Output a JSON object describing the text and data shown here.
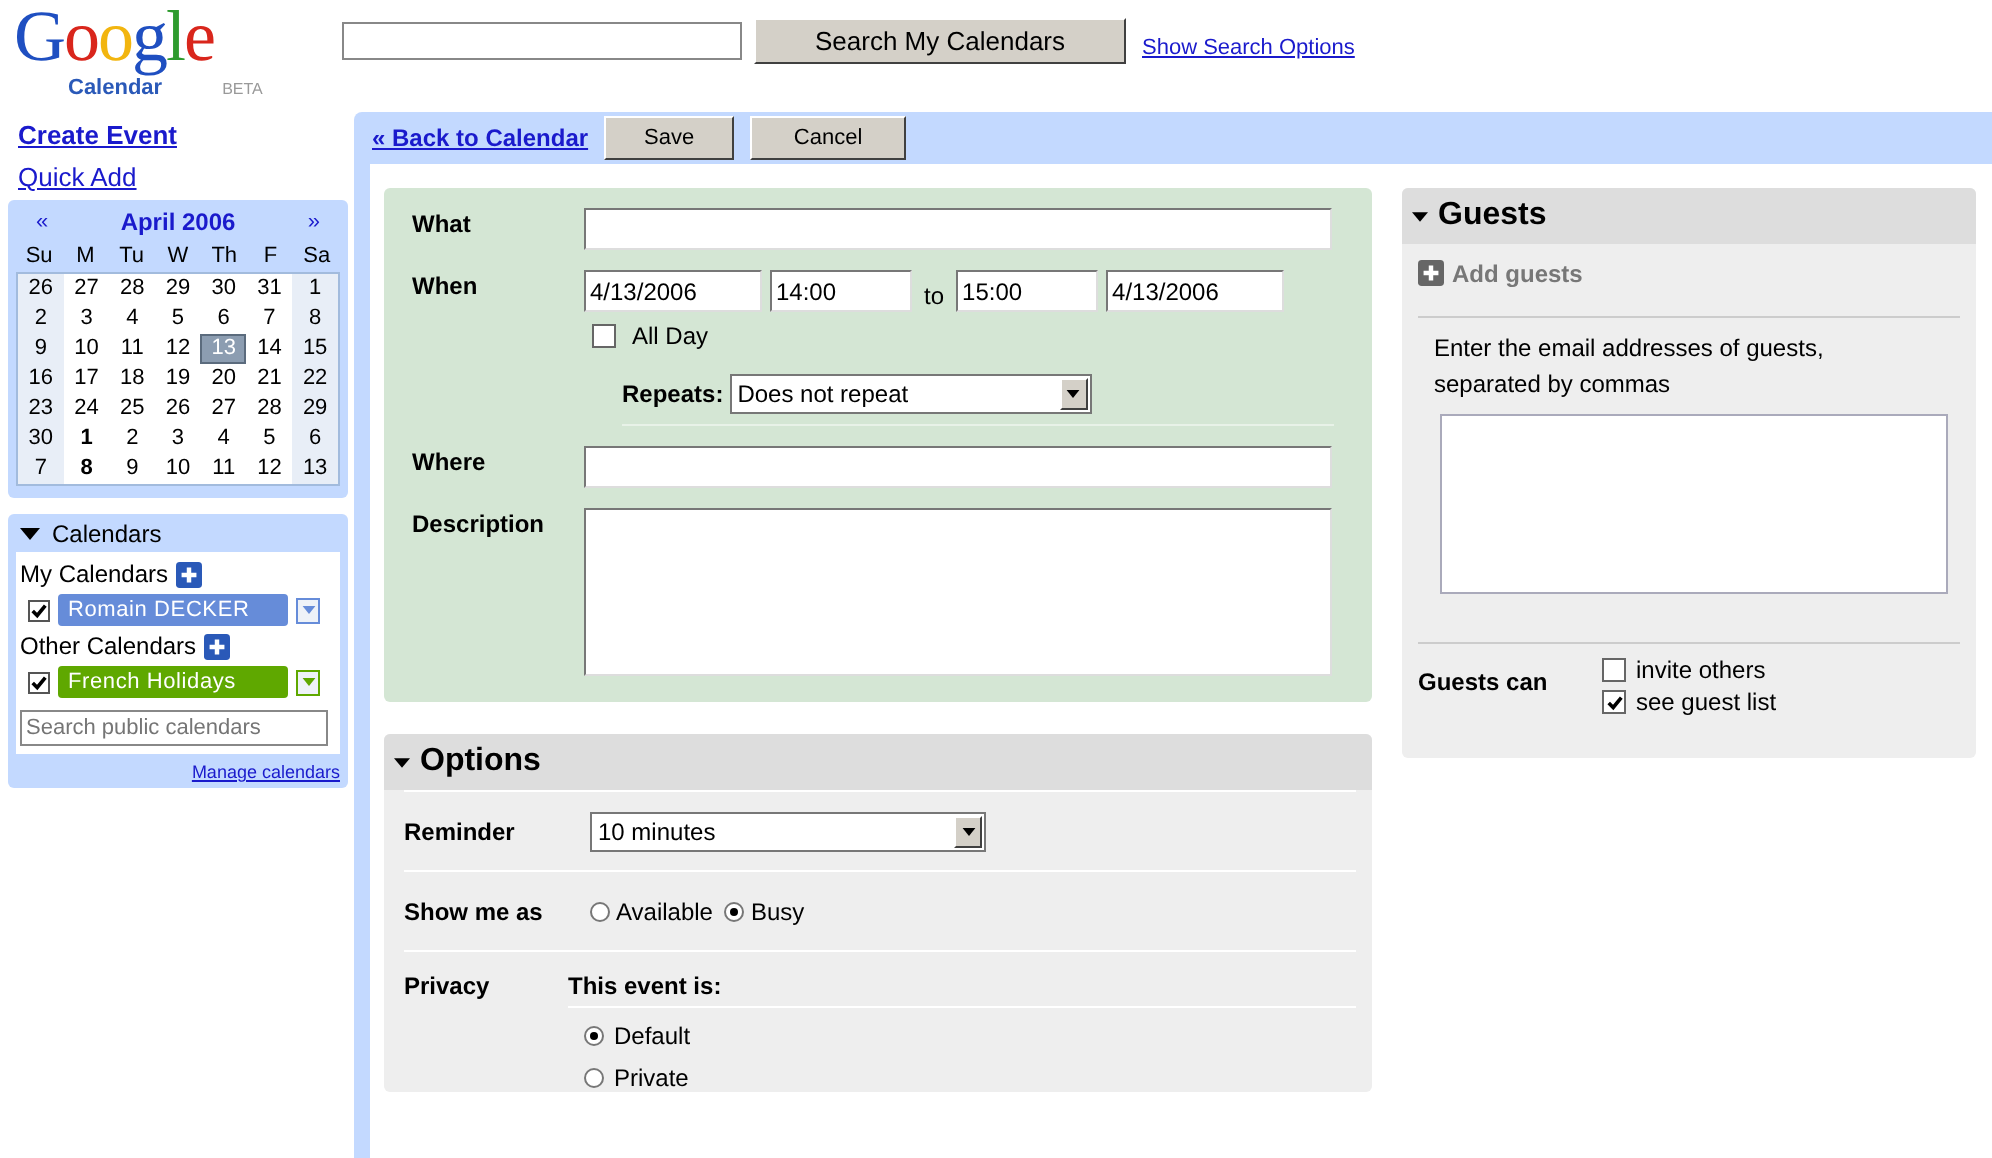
{
  "header": {
    "logo_word": "Google",
    "logo_sub": "Calendar",
    "logo_badge": "BETA",
    "search_button": "Search My Calendars",
    "search_options_link": "Show Search Options"
  },
  "sidebar": {
    "create_event": "Create Event",
    "quick_add": "Quick Add",
    "mini_calendar": {
      "prev": "«",
      "month": "April 2006",
      "next": "»",
      "weekdays": [
        "Su",
        "M",
        "Tu",
        "W",
        "Th",
        "F",
        "Sa"
      ],
      "weeks": [
        [
          {
            "day": "26",
            "selected": false,
            "bold": false
          },
          {
            "day": "27",
            "selected": false,
            "bold": false
          },
          {
            "day": "28",
            "selected": false,
            "bold": false
          },
          {
            "day": "29",
            "selected": false,
            "bold": false
          },
          {
            "day": "30",
            "selected": false,
            "bold": false
          },
          {
            "day": "31",
            "selected": false,
            "bold": false
          },
          {
            "day": "1",
            "selected": false,
            "bold": false
          }
        ],
        [
          {
            "day": "2",
            "selected": false,
            "bold": false
          },
          {
            "day": "3",
            "selected": false,
            "bold": false
          },
          {
            "day": "4",
            "selected": false,
            "bold": false
          },
          {
            "day": "5",
            "selected": false,
            "bold": false
          },
          {
            "day": "6",
            "selected": false,
            "bold": false
          },
          {
            "day": "7",
            "selected": false,
            "bold": false
          },
          {
            "day": "8",
            "selected": false,
            "bold": false
          }
        ],
        [
          {
            "day": "9",
            "selected": false,
            "bold": false
          },
          {
            "day": "10",
            "selected": false,
            "bold": false
          },
          {
            "day": "11",
            "selected": false,
            "bold": false
          },
          {
            "day": "12",
            "selected": false,
            "bold": false
          },
          {
            "day": "13",
            "selected": true,
            "bold": false
          },
          {
            "day": "14",
            "selected": false,
            "bold": false
          },
          {
            "day": "15",
            "selected": false,
            "bold": false
          }
        ],
        [
          {
            "day": "16",
            "selected": false,
            "bold": false
          },
          {
            "day": "17",
            "selected": false,
            "bold": false
          },
          {
            "day": "18",
            "selected": false,
            "bold": false
          },
          {
            "day": "19",
            "selected": false,
            "bold": false
          },
          {
            "day": "20",
            "selected": false,
            "bold": false
          },
          {
            "day": "21",
            "selected": false,
            "bold": false
          },
          {
            "day": "22",
            "selected": false,
            "bold": false
          }
        ],
        [
          {
            "day": "23",
            "selected": false,
            "bold": false
          },
          {
            "day": "24",
            "selected": false,
            "bold": false
          },
          {
            "day": "25",
            "selected": false,
            "bold": false
          },
          {
            "day": "26",
            "selected": false,
            "bold": false
          },
          {
            "day": "27",
            "selected": false,
            "bold": false
          },
          {
            "day": "28",
            "selected": false,
            "bold": false
          },
          {
            "day": "29",
            "selected": false,
            "bold": false
          }
        ],
        [
          {
            "day": "30",
            "selected": false,
            "bold": false
          },
          {
            "day": "1",
            "selected": false,
            "bold": true
          },
          {
            "day": "2",
            "selected": false,
            "bold": false
          },
          {
            "day": "3",
            "selected": false,
            "bold": false
          },
          {
            "day": "4",
            "selected": false,
            "bold": false
          },
          {
            "day": "5",
            "selected": false,
            "bold": false
          },
          {
            "day": "6",
            "selected": false,
            "bold": false
          }
        ],
        [
          {
            "day": "7",
            "selected": false,
            "bold": false
          },
          {
            "day": "8",
            "selected": false,
            "bold": true
          },
          {
            "day": "9",
            "selected": false,
            "bold": false
          },
          {
            "day": "10",
            "selected": false,
            "bold": false
          },
          {
            "day": "11",
            "selected": false,
            "bold": false
          },
          {
            "day": "12",
            "selected": false,
            "bold": false
          },
          {
            "day": "13",
            "selected": false,
            "bold": false
          }
        ]
      ]
    },
    "calendars": {
      "title": "Calendars",
      "expanded": true,
      "groups": [
        {
          "label": "My Calendars",
          "items": [
            {
              "name": "Romain DECKER",
              "checked": true,
              "color": "#668cd9"
            }
          ]
        },
        {
          "label": "Other Calendars",
          "items": [
            {
              "name": "French Holidays",
              "checked": true,
              "color": "#5fa800"
            }
          ]
        }
      ],
      "search_placeholder": "Search public calendars",
      "manage_link": "Manage calendars"
    }
  },
  "toolbar": {
    "back_link": "« Back to Calendar",
    "buttons": [
      "Save",
      "Cancel"
    ]
  },
  "event_form": {
    "what_label": "What",
    "when_label": "When",
    "start_date": "4/13/2006",
    "start_time": "14:00",
    "to": "to",
    "end_time": "15:00",
    "end_date": "4/13/2006",
    "all_day": {
      "label": "All Day",
      "checked": false
    },
    "repeats_label": "Repeats:",
    "repeats_value": "Does not repeat",
    "where_label": "Where",
    "description_label": "Description"
  },
  "options": {
    "title": "Options",
    "expanded": true,
    "reminder_label": "Reminder",
    "reminder_value": "10 minutes",
    "show_me_as_label": "Show me as",
    "show_me_as": [
      {
        "label": "Available",
        "selected": false
      },
      {
        "label": "Busy",
        "selected": true
      }
    ],
    "privacy_label": "Privacy",
    "privacy_heading": "This event is:",
    "privacy": [
      {
        "label": "Default",
        "selected": true
      },
      {
        "label": "Private",
        "selected": false
      }
    ]
  },
  "guests": {
    "title": "Guests",
    "expanded": true,
    "add_guests": "Add guests",
    "instructions": "Enter the email addresses of guests, separated by commas",
    "guests_can_label": "Guests can",
    "permissions": [
      {
        "label": "invite others",
        "checked": false
      },
      {
        "label": "see guest list",
        "checked": true
      }
    ]
  }
}
